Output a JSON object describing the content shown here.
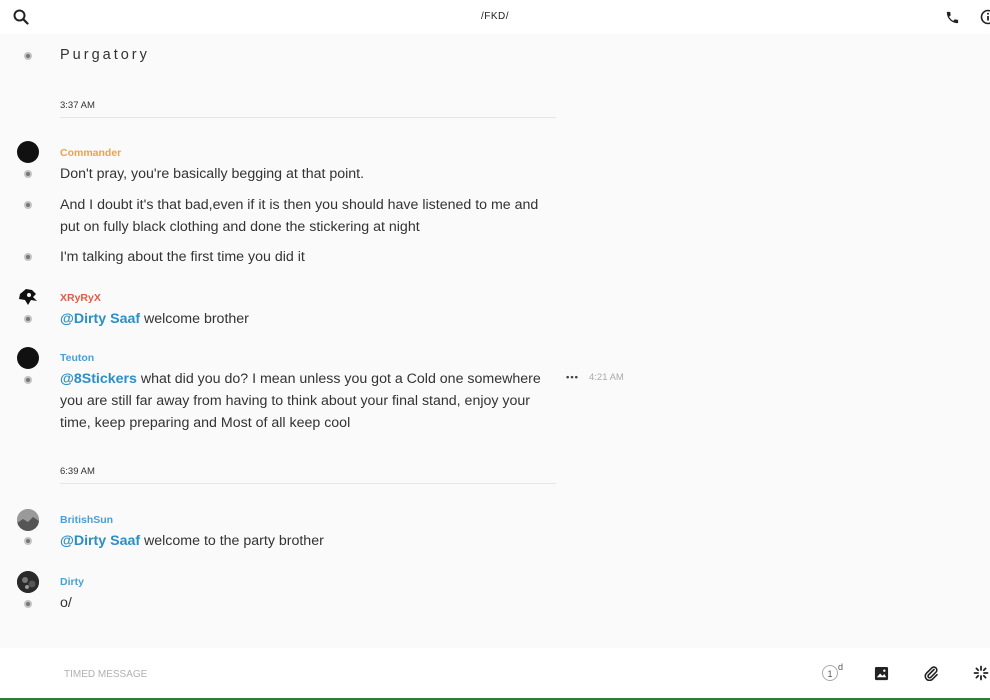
{
  "header": {
    "title": "/FKD/",
    "search_icon": "search-icon",
    "call_icon": "phone-icon",
    "info_icon": "info-icon"
  },
  "channel": {
    "name": "Purgatory"
  },
  "day_separators": [
    {
      "time": "3:37 AM"
    },
    {
      "time": "6:39 AM"
    }
  ],
  "messages": [
    {
      "author": "Commander",
      "author_color": "#f0a14a",
      "text": "Don't pray, you're basically begging at that point."
    },
    {
      "text": "And I doubt it's that bad,even if it is then you should have listened to me and put on fully black clothing and done the stickering at night"
    },
    {
      "text": "I'm talking about the first time you did it"
    },
    {
      "author": "XRyRyX",
      "author_color": "#e25a4a",
      "mention": "@Dirty Saaf",
      "text": " welcome brother"
    },
    {
      "author": "Teuton",
      "author_color": "#4a9fd4",
      "mention": "@8Stickers",
      "text": " what did you do? I mean unless you got a Cold one somewhere you are still far away from having to think about your final stand, enjoy your time, keep preparing and Most of all keep cool",
      "timestamp": "4:21 AM",
      "more": "•••"
    },
    {
      "author": "BritishSun",
      "author_color": "#4a9fd4",
      "mention": "@Dirty Saaf",
      "text": " welcome to the party brother"
    },
    {
      "author": "Dirty",
      "author_color": "#4a9fd4",
      "text": "o/"
    }
  ],
  "composer": {
    "placeholder": "TIMED MESSAGE",
    "timer_value": "1",
    "timer_unit": "d",
    "image_icon": "image-icon",
    "attach_icon": "paperclip-icon",
    "sparkle_icon": "sparkle-icon"
  },
  "colors": {
    "mention": "#2b8fc7",
    "accent_bottom": "#2e7d32"
  }
}
